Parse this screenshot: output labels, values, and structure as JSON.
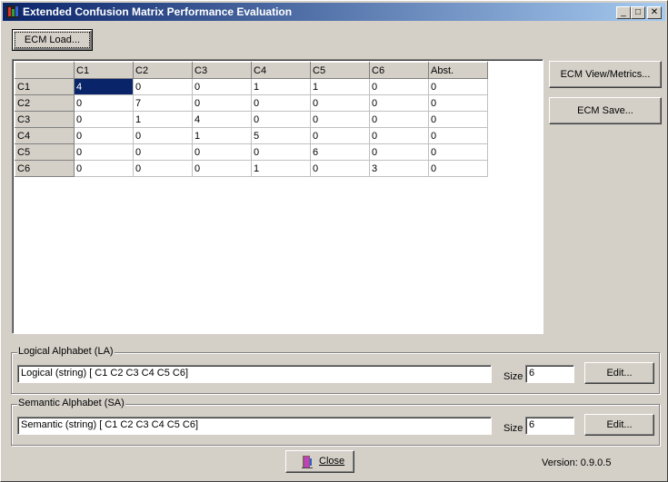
{
  "window": {
    "title": "Extended Confusion Matrix Performance Evaluation"
  },
  "toolbar": {
    "load_label": "ECM Load..."
  },
  "side_buttons": {
    "view_label": "ECM View/Metrics...",
    "save_label": "ECM Save..."
  },
  "matrix": {
    "headers": [
      "C1",
      "C2",
      "C3",
      "C4",
      "C5",
      "C6",
      "Abst."
    ],
    "rows": [
      {
        "label": "C1",
        "cells": [
          "4",
          "0",
          "0",
          "1",
          "1",
          "0",
          "0"
        ]
      },
      {
        "label": "C2",
        "cells": [
          "0",
          "7",
          "0",
          "0",
          "0",
          "0",
          "0"
        ]
      },
      {
        "label": "C3",
        "cells": [
          "0",
          "1",
          "4",
          "0",
          "0",
          "0",
          "0"
        ]
      },
      {
        "label": "C4",
        "cells": [
          "0",
          "0",
          "1",
          "5",
          "0",
          "0",
          "0"
        ]
      },
      {
        "label": "C5",
        "cells": [
          "0",
          "0",
          "0",
          "0",
          "6",
          "0",
          "0"
        ]
      },
      {
        "label": "C6",
        "cells": [
          "0",
          "0",
          "0",
          "1",
          "0",
          "3",
          "0"
        ]
      }
    ]
  },
  "logical": {
    "group_label": "Logical Alphabet (LA)",
    "value": "Logical (string)  [ C1 C2 C3 C4 C5 C6]",
    "size_label": "Size",
    "size_value": "6",
    "edit_label": "Edit..."
  },
  "semantic": {
    "group_label": "Semantic Alphabet (SA)",
    "value": "Semantic (string)  [ C1 C2 C3 C4 C5 C6]",
    "size_label": "Size",
    "size_value": "6",
    "edit_label": "Edit..."
  },
  "footer": {
    "close_label": "Close",
    "version": "Version: 0.9.0.5"
  }
}
